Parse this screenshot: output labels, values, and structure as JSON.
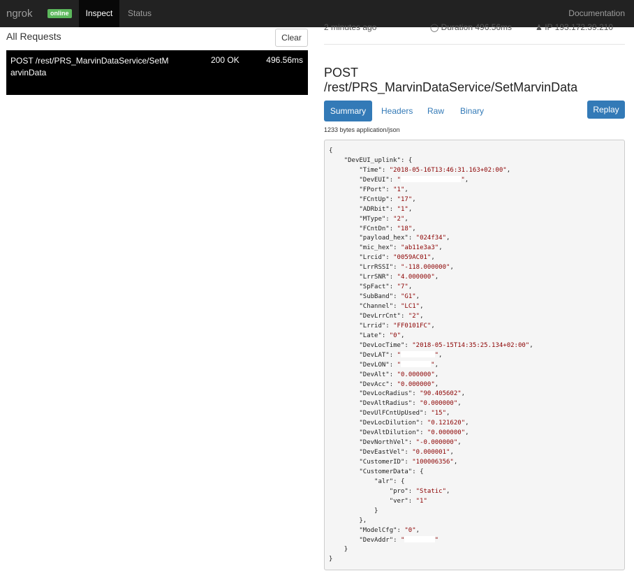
{
  "nav": {
    "brand": "ngrok",
    "badge": "online",
    "inspect": "Inspect",
    "status": "Status",
    "documentation": "Documentation"
  },
  "requests": {
    "title": "All Requests",
    "clear_label": "Clear",
    "items": [
      {
        "text": "POST /rest/PRS_MarvinDataService/SetMarvinData",
        "status": "200 OK",
        "duration": "496.56ms"
      }
    ]
  },
  "detail": {
    "ago": "2 minutes ago",
    "duration": "Duration 496.56ms",
    "ip": "IP 193.172.39.210",
    "method": "POST",
    "path": "/rest/PRS_MarvinDataService/SetMarvinData",
    "tabs": [
      "Summary",
      "Headers",
      "Raw",
      "Binary"
    ],
    "replay_label": "Replay",
    "size_info": "1233 bytes application/json"
  },
  "json_body": [
    {
      "indent": 0,
      "text": "{"
    },
    {
      "indent": 1,
      "key": "DevEUI_uplink",
      "open": "{"
    },
    {
      "indent": 2,
      "key": "Time",
      "value": "2018-05-16T13:46:31.163+02:00"
    },
    {
      "indent": 2,
      "key": "DevEUI",
      "value": "",
      "redacted": 16
    },
    {
      "indent": 2,
      "key": "FPort",
      "value": "1"
    },
    {
      "indent": 2,
      "key": "FCntUp",
      "value": "17"
    },
    {
      "indent": 2,
      "key": "ADRbit",
      "value": "1"
    },
    {
      "indent": 2,
      "key": "MType",
      "value": "2"
    },
    {
      "indent": 2,
      "key": "FCntDn",
      "value": "18"
    },
    {
      "indent": 2,
      "key": "payload_hex",
      "value": "024f34"
    },
    {
      "indent": 2,
      "key": "mic_hex",
      "value": "ab11e3a3"
    },
    {
      "indent": 2,
      "key": "Lrcid",
      "value": "0059AC01"
    },
    {
      "indent": 2,
      "key": "LrrRSSI",
      "value": "-118.000000"
    },
    {
      "indent": 2,
      "key": "LrrSNR",
      "value": "4.000000"
    },
    {
      "indent": 2,
      "key": "SpFact",
      "value": "7"
    },
    {
      "indent": 2,
      "key": "SubBand",
      "value": "G1"
    },
    {
      "indent": 2,
      "key": "Channel",
      "value": "LC1"
    },
    {
      "indent": 2,
      "key": "DevLrrCnt",
      "value": "2"
    },
    {
      "indent": 2,
      "key": "Lrrid",
      "value": "FF0101FC"
    },
    {
      "indent": 2,
      "key": "Late",
      "value": "0"
    },
    {
      "indent": 2,
      "key": "DevLocTime",
      "value": "2018-05-15T14:35:25.134+02:00"
    },
    {
      "indent": 2,
      "key": "DevLAT",
      "value": "",
      "redacted": 9
    },
    {
      "indent": 2,
      "key": "DevLON",
      "value": "",
      "redacted": 8
    },
    {
      "indent": 2,
      "key": "DevAlt",
      "value": "0.000000"
    },
    {
      "indent": 2,
      "key": "DevAcc",
      "value": "0.000000"
    },
    {
      "indent": 2,
      "key": "DevLocRadius",
      "value": "90.405602"
    },
    {
      "indent": 2,
      "key": "DevAltRadius",
      "value": "0.000000"
    },
    {
      "indent": 2,
      "key": "DevUlFCntUpUsed",
      "value": "15"
    },
    {
      "indent": 2,
      "key": "DevLocDilution",
      "value": "0.121620"
    },
    {
      "indent": 2,
      "key": "DevAltDilution",
      "value": "0.000000"
    },
    {
      "indent": 2,
      "key": "DevNorthVel",
      "value": "-0.000000"
    },
    {
      "indent": 2,
      "key": "DevEastVel",
      "value": "0.000001"
    },
    {
      "indent": 2,
      "key": "CustomerID",
      "value": "100006356"
    },
    {
      "indent": 2,
      "key": "CustomerData",
      "open": "{"
    },
    {
      "indent": 3,
      "key": "alr",
      "open": "{"
    },
    {
      "indent": 4,
      "key": "pro",
      "value": "Static"
    },
    {
      "indent": 4,
      "key": "ver",
      "value": "1",
      "last": true
    },
    {
      "indent": 3,
      "text": "}"
    },
    {
      "indent": 2,
      "text": "},"
    },
    {
      "indent": 2,
      "key": "ModelCfg",
      "value": "0"
    },
    {
      "indent": 2,
      "key": "DevAddr",
      "value": "",
      "redacted": 8,
      "last": true
    },
    {
      "indent": 1,
      "text": "}"
    },
    {
      "indent": 0,
      "text": "}"
    }
  ]
}
